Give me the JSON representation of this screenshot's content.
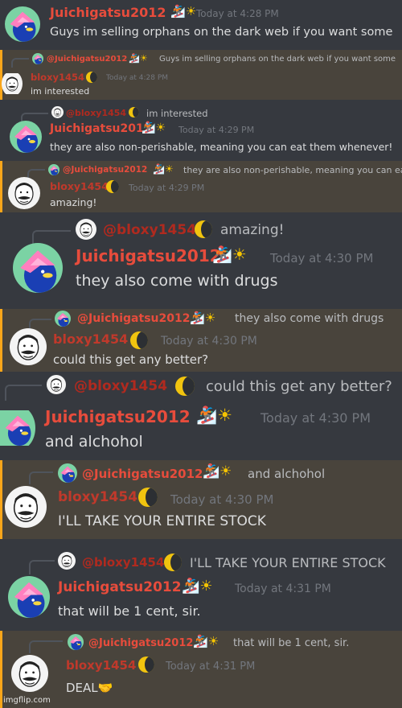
{
  "users": {
    "juich": {
      "name": "Juichigatsu2012",
      "mention": "@Juichigatsu2012"
    },
    "bloxy": {
      "name": "bloxy1454",
      "mention": "@bloxy1454"
    }
  },
  "chunks": [
    {
      "author": "Juichigatsu2012",
      "timestamp": "Today at 4:28 PM",
      "text": "Guys im selling orphans on the dark web if you want some"
    },
    {
      "reply_author": "@Juichigatsu2012",
      "reply_text": "Guys im selling orphans on the dark web if you want some",
      "author": "bloxy1454",
      "timestamp": "Today at 4:28 PM",
      "text": "im interested"
    },
    {
      "reply_author": "@bloxy1454",
      "reply_text": "im interested",
      "author": "Juichigatsu2012",
      "timestamp": "Today at 4:29 PM",
      "text": "they are also non-perishable, meaning you can eat them whenever!"
    },
    {
      "reply_author": "@Juichigatsu2012",
      "reply_text": "they are also non-perishable, meaning you can ea",
      "author": "bloxy1454",
      "timestamp": "Today at 4:29 PM",
      "text": "amazing!"
    },
    {
      "reply_author": "@bloxy1454",
      "reply_text": "amazing!",
      "author": "Juichigatsu2012",
      "timestamp": "Today at 4:30 PM",
      "text": "they also come with drugs"
    },
    {
      "reply_author": "@Juichigatsu2012",
      "reply_text": "they also come with drugs",
      "author": "bloxy1454",
      "timestamp": "Today at 4:30 PM",
      "text": "could this get any better?"
    },
    {
      "reply_author": "@bloxy1454",
      "reply_text": "could this get any better?",
      "author": "Juichigatsu2012",
      "timestamp": "Today at 4:30 PM",
      "text": "and alchohol"
    },
    {
      "reply_author": "@Juichigatsu2012",
      "reply_text": "and alchohol",
      "author": "bloxy1454",
      "timestamp": "Today at 4:30 PM",
      "text": "I'LL TAKE YOUR ENTIRE STOCK"
    },
    {
      "reply_author": "@bloxy1454",
      "reply_text": "I'LL TAKE YOUR ENTIRE STOCK",
      "author": "Juichigatsu2012",
      "timestamp": "Today at 4:31 PM",
      "text": "that will be 1 cent, sir."
    },
    {
      "reply_author": "@Juichigatsu2012",
      "reply_text": "that will be 1 cent, sir.",
      "author": "bloxy1454",
      "timestamp": "Today at 4:31 PM",
      "text": "DEAL🤝"
    }
  ],
  "badges": {
    "juich": "🏂☀️",
    "bloxy": "🌘"
  },
  "watermark": "imgflip.com",
  "colors": {
    "background": "#36393f",
    "mention_bg": "#49443c",
    "mention_bar": "#faa61a",
    "username_red": "#e74c3c",
    "timestamp": "#72767d"
  },
  "icons": {
    "juich_avatar": "pink-house-bird-avatar",
    "bloxy_avatar": "mustached-man-meme-avatar",
    "snowboarder": "snowboarder-emoji",
    "sun": "sun-emoji",
    "moon": "crescent-moon-emoji",
    "handshake": "handshake-emoji"
  }
}
